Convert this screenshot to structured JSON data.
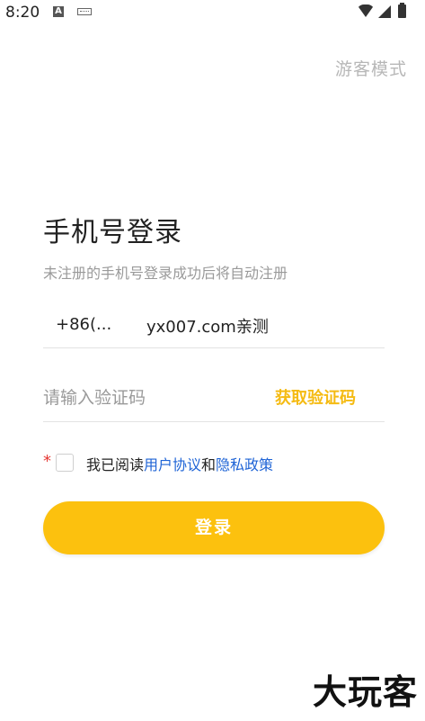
{
  "status_bar": {
    "time": "8:20",
    "a_icon": "A"
  },
  "header": {
    "guest_mode": "游客模式"
  },
  "login": {
    "title": "手机号登录",
    "subtitle": "未注册的手机号登录成功后将自动注册",
    "country_code": "+86(...",
    "phone_value": "yx007.com亲测",
    "code_placeholder": "请输入验证码",
    "get_code_label": "获取验证码",
    "required_star": "*",
    "agree_prefix": "我已阅读",
    "user_agreement": "用户协议",
    "agree_and": "和",
    "privacy_policy": "隐私政策",
    "login_button": "登录"
  },
  "watermark": {
    "text": "大玩客"
  },
  "colors": {
    "accent": "#fcc10e",
    "link": "#1f64d6",
    "required": "#e53935",
    "muted": "#9a9a9a"
  }
}
